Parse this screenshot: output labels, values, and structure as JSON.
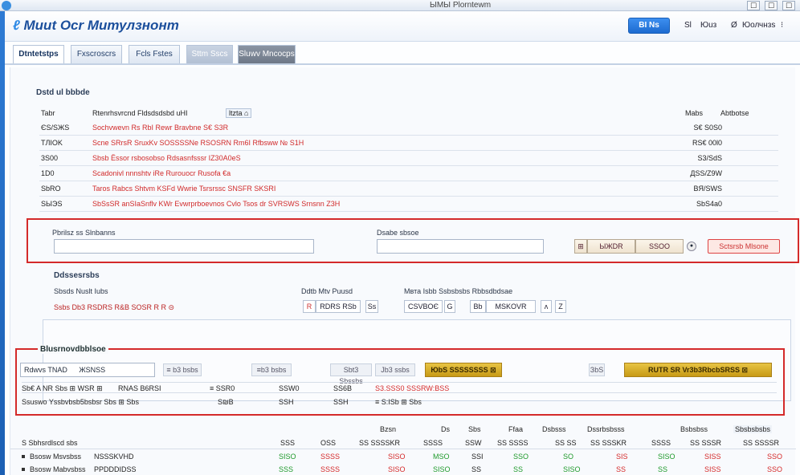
{
  "titlebar": {
    "title": "ЫМЫ Рlorntewm",
    "btn_min": "☐",
    "btn_max": "☐",
    "btn_close": "☐"
  },
  "header": {
    "logo_mark": "ℓ",
    "logo_text": "Мuut Ocr Митулзнонт",
    "primary_button": "ВІ Ns",
    "link1": "Sl",
    "link2": "Юuз",
    "link3": "Ø",
    "link4": "Юолчнзs",
    "link5": "⁝"
  },
  "tabs": [
    "Dtntetstps",
    "Fxscroscrs",
    "Fcls Fstes",
    "Sttm Sscs",
    "Sluwv Mncocps"
  ],
  "details": {
    "title": "Dstd ul bbbde",
    "col_type": "Tabr",
    "col_desc": "Rtenrhsvrcnd Fldsdsdsbd uHI",
    "col_desc_badge": "ltzta ⌂",
    "col_amt": "Mabs",
    "col_action": "Abtbotse",
    "rows": [
      {
        "id": "ЄS/SЖS",
        "desc": "Sochvwevn Rs RbI Rewr Bravbne S€ S3R",
        "amt": "S€ S0S0"
      },
      {
        "id": "TЛIOK",
        "desc": "Scne SRrsR SruxKv SOSSSSNe RSOSRN Rm6I Rfbsww № S1H",
        "amt": "RS€ 00l0"
      },
      {
        "id": "3S00",
        "desc": "Sbsb Ёssor rsbosobso Rdsasnfsssr IZ30A0eS",
        "amt": "S3/SdS"
      },
      {
        "id": "1D0",
        "desc": "Scadonivl nnnshtv iRe Rurouocr Rusofa €a",
        "amt": "ДSS/Z9W"
      },
      {
        "id": "SbRO",
        "desc": "Taros Rabcs Shtvm  KSFd Wwrie Tsrsrssc SNSFR SKSRI",
        "amt": "BЯ/SWS"
      },
      {
        "id": "SЫЭS",
        "desc": "SbSsSR anSIaSnflv KWr Evwrprboevnos  Cvlo Tsos dr SVRSWS Srnsnn Z3H",
        "amt": "SbS4a0"
      }
    ]
  },
  "filter": {
    "label1": "Pbrilsz ss Slnbanns",
    "label2": "Dsabe sbsoe",
    "seg_left": "⊞",
    "seg_mid": "ЫЖDR",
    "seg_right": "SSOO",
    "circle": "●",
    "btn": "Sctsrsb Mlsone"
  },
  "subpanel": {
    "title": "Ddssesrsbs",
    "label1": "Sbsds Nuslt Iubs",
    "value1": "Ssbs Db3 RSDRS R&B SOSR R R ⊝",
    "label2": "Ddtb Mtv Puusd",
    "box_a": "R",
    "box_b": "RDRS RSb",
    "box_c": "Ss",
    "label3": "Мвта Isbb Ssbsbsbs Rbbsdbdsae",
    "box_d": "CSVBOЄ",
    "box_e": "G",
    "box_f": "Bb",
    "box_g": "MSKOVR",
    "box_h": "ʌ",
    "box_i": "Z"
  },
  "orders": {
    "title": "Blusrnovdbblsoe",
    "input_label": "Rdwvs TNAD",
    "input_value": "ЖSNSS",
    "grey1": "≡ b3 bsbs",
    "grey2": "≡b3 bsbs",
    "grey3": "Sbt3 Sbssbs",
    "grey4": "Jb3 ssbs",
    "gold1": "ЮbS SSSSSSSS ⊠",
    "grey5": "ЗbS",
    "gold2": "RUTR SR Vr3b3RbcbSRSS ⊠",
    "row1": {
      "a": "Sb€ A NR Sbs ⊞ WSR ⊞",
      "b": "RNAS B6RSI",
      "c": "≡ SSR0",
      "d": "SSW0",
      "e": "SS6B",
      "f": "S3.SSS0 SSSRW:BSS"
    },
    "row2": {
      "a": "Ssuswo Yssbvbsb5bsbsr Sbs ⊞ Sbs",
      "b": "S₪B",
      "c": "SSH",
      "d": "SSH",
      "e": "≡ S:ISb ⊞ Sbs"
    }
  },
  "summary": {
    "headers": [
      "Bzsn",
      "Ds",
      "Sbs",
      "Ffaa",
      "Dsbsss",
      "Dssrbsbsss",
      "Bsbsbss",
      "Sbsbsbsbs"
    ],
    "sub_headers": [
      "S Sbhsrdlscd sbs",
      "SSS",
      "OSS",
      "SS SSSSKR",
      "SSSS",
      "SSW",
      "SS SSSS",
      "SS SS",
      "SS SSSKR",
      "SSSS",
      "SS SSSR",
      "SS SSSSR"
    ],
    "rows": [
      {
        "label": "Bsosw Msvsbss",
        "tag": "NSSSKVHD",
        "vals": [
          "SISO",
          "SSSS",
          "SISO",
          "MSO",
          "SSI",
          "SSO",
          "SO",
          "SIS",
          "SISO",
          "SISS",
          "SSO"
        ]
      },
      {
        "label": "Bsosw Mabvsbss",
        "tag": "PPDDDIDSS",
        "vals": [
          "SSS",
          "SSSS",
          "SISO",
          "SISO",
          "SS",
          "SS",
          "SISO",
          "SS",
          "SS",
          "SISS",
          "SSO"
        ]
      }
    ]
  },
  "colors": {
    "accent": "#1d6bd0",
    "alert": "#d42a2a",
    "gold": "#d4aa26",
    "positive": "#1f9a2c"
  }
}
